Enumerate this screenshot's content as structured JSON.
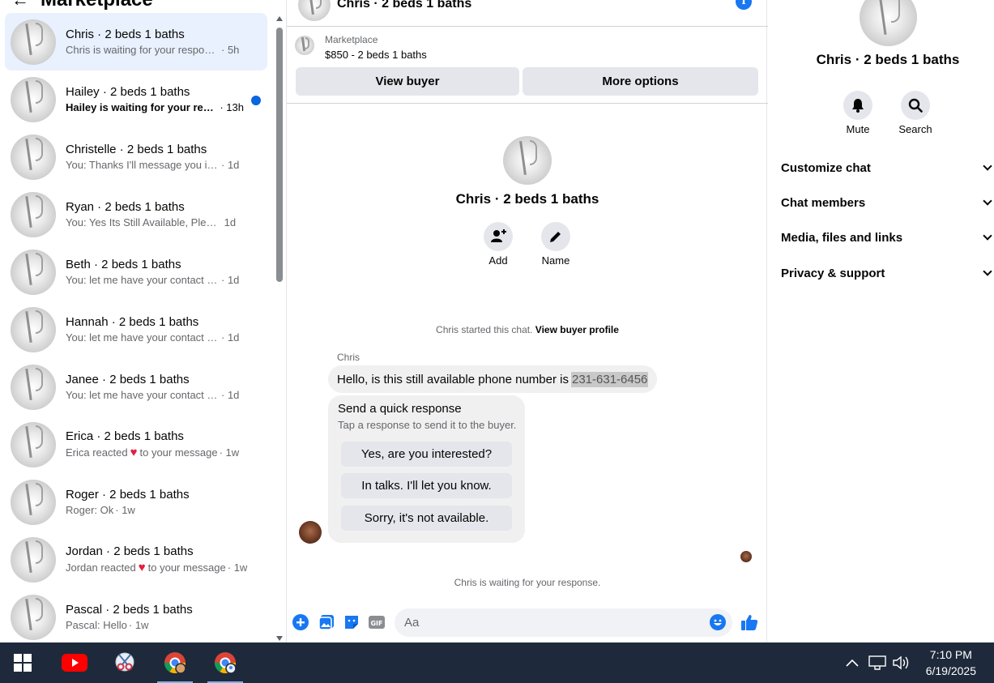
{
  "sidebar": {
    "title": "Marketplace",
    "conversations": [
      {
        "name": "Chris · 2 beds 1 baths",
        "snippet": "Chris is waiting for your response.",
        "time": "· 5h",
        "active": true,
        "unread": false,
        "heart": false
      },
      {
        "name": "Hailey · 2 beds 1 baths",
        "snippet": "Hailey is waiting for your resp...",
        "time": "· 13h",
        "active": false,
        "unread": true,
        "heart": false
      },
      {
        "name": "Christelle · 2 beds 1 baths",
        "snippet": "You: Thanks I'll message you in a m...",
        "time": "· 1d",
        "active": false,
        "unread": false,
        "heart": false
      },
      {
        "name": "Ryan · 2 beds 1 baths",
        "snippet": "You: Yes Its Still Available, Please Se...",
        "time": "1d",
        "active": false,
        "unread": false,
        "heart": false
      },
      {
        "name": "Beth · 2 beds 1 baths",
        "snippet": "You: let me have your contact num...",
        "time": "· 1d",
        "active": false,
        "unread": false,
        "heart": false
      },
      {
        "name": "Hannah · 2 beds 1 baths",
        "snippet": "You: let me have your contact num...",
        "time": "· 1d",
        "active": false,
        "unread": false,
        "heart": false
      },
      {
        "name": "Janee · 2 beds 1 baths",
        "snippet": "You: let me have your contact num...",
        "time": "· 1d",
        "active": false,
        "unread": false,
        "heart": false
      },
      {
        "name": "Erica · 2 beds 1 baths",
        "snippet": "Erica reacted",
        "snippet_after": "to your message",
        "time": "· 1w",
        "active": false,
        "unread": false,
        "heart": true
      },
      {
        "name": "Roger · 2 beds 1 baths",
        "snippet": "Roger: Ok",
        "time": "· 1w",
        "active": false,
        "unread": false,
        "heart": false
      },
      {
        "name": "Jordan · 2 beds 1 baths",
        "snippet": "Jordan reacted",
        "snippet_after": "to your message",
        "time": "· 1w",
        "active": false,
        "unread": false,
        "heart": true
      },
      {
        "name": "Pascal · 2 beds 1 baths",
        "snippet": "Pascal: Hello",
        "time": "· 1w",
        "active": false,
        "unread": false,
        "heart": false
      }
    ]
  },
  "chat": {
    "header_name": "Chris · 2 beds 1 baths",
    "listing_label": "Marketplace",
    "listing_price": "$850 - 2 beds 1 baths",
    "view_buyer": "View buyer",
    "more_options": "More options",
    "profile_name": "Chris · 2 beds 1 baths",
    "add_label": "Add",
    "name_label": "Name",
    "started_text": "Chris started this chat.",
    "view_profile": "View buyer profile",
    "sender": "Chris",
    "message_text": "Hello, is this still available phone number is",
    "message_phone": "231-631-6456",
    "quick_title": "Send a quick response",
    "quick_subtitle": "Tap a response to send it to the buyer.",
    "quick_replies": [
      "Yes, are you interested?",
      "In talks. I'll let you know.",
      "Sorry, it's not available."
    ],
    "waiting_text": "Chris is waiting for your response.",
    "composer_placeholder": "Aa"
  },
  "right_panel": {
    "name": "Chris · 2 beds 1 baths",
    "mute_label": "Mute",
    "search_label": "Search",
    "sections": [
      "Customize chat",
      "Chat members",
      "Media, files and links",
      "Privacy & support"
    ]
  },
  "taskbar": {
    "time": "7:10 PM",
    "date": "6/19/2025"
  },
  "colors": {
    "accent": "#1877f2",
    "active_row": "#e8f1fd",
    "unread_dot": "#0a66e0",
    "heart": "#e41e3f",
    "taskbar": "#1e2a3b"
  }
}
